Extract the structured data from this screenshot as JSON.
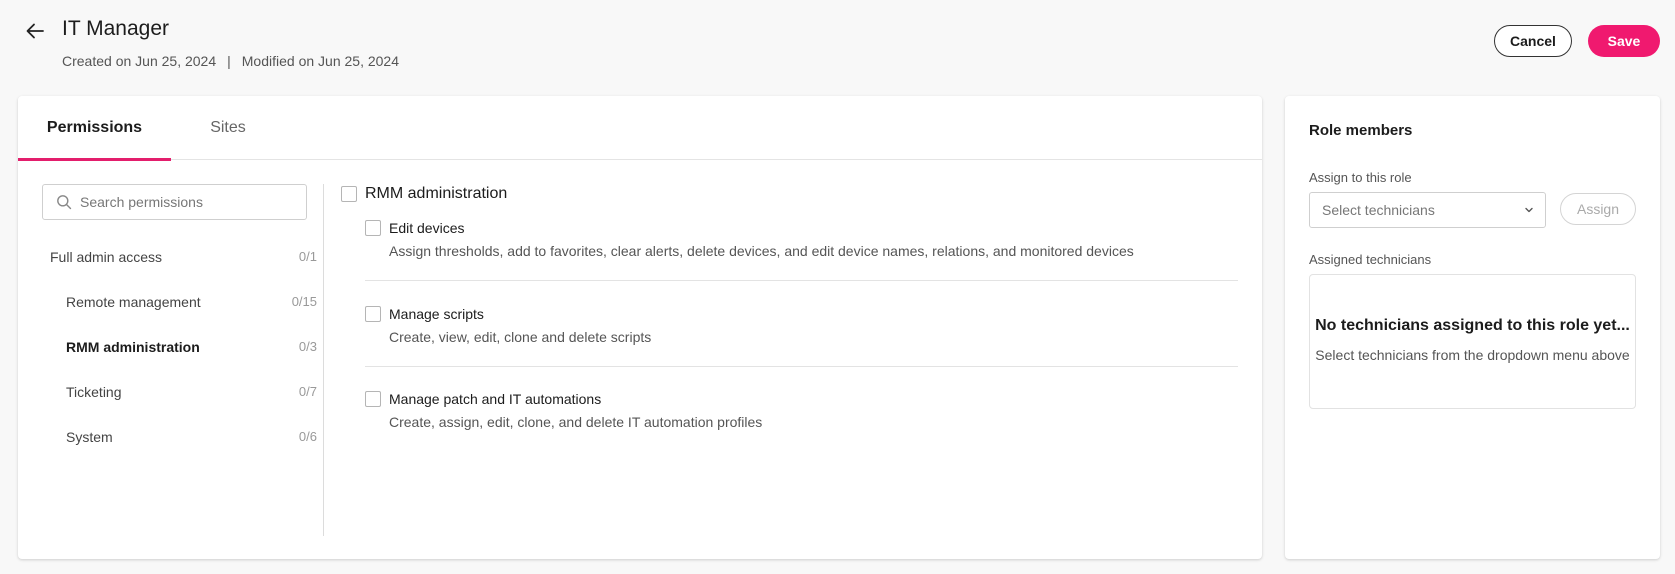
{
  "header": {
    "title": "IT Manager",
    "created": "Created on Jun 25, 2024",
    "separator": "|",
    "modified": "Modified on Jun 25, 2024",
    "cancel_label": "Cancel",
    "save_label": "Save"
  },
  "tabs": [
    {
      "label": "Permissions",
      "active": true
    },
    {
      "label": "Sites",
      "active": false
    }
  ],
  "search": {
    "placeholder": "Search permissions",
    "value": ""
  },
  "nav": [
    {
      "label": "Full admin access",
      "count": "0/1"
    },
    {
      "label": "Remote management",
      "count": "0/15"
    },
    {
      "label": "RMM administration",
      "count": "0/3"
    },
    {
      "label": "Ticketing",
      "count": "0/7"
    },
    {
      "label": "System",
      "count": "0/6"
    }
  ],
  "section": {
    "title": "RMM administration",
    "permissions": [
      {
        "name": "Edit devices",
        "description": "Assign thresholds, add to favorites, clear alerts, delete devices, and edit device names, relations, and monitored devices"
      },
      {
        "name": "Manage scripts",
        "description": "Create, view, edit, clone and delete scripts"
      },
      {
        "name": "Manage patch and IT automations",
        "description": "Create, assign, edit, clone, and delete IT automation profiles"
      }
    ]
  },
  "role_members": {
    "title": "Role members",
    "assign_label": "Assign to this role",
    "select_placeholder": "Select technicians",
    "assign_button": "Assign",
    "assigned_label": "Assigned technicians",
    "empty_title": "No technicians assigned to this role yet...",
    "empty_subtitle": "Select technicians from the dropdown menu above"
  },
  "colors": {
    "accent": "#f0196f",
    "tab_underline": "#e31e6c"
  }
}
